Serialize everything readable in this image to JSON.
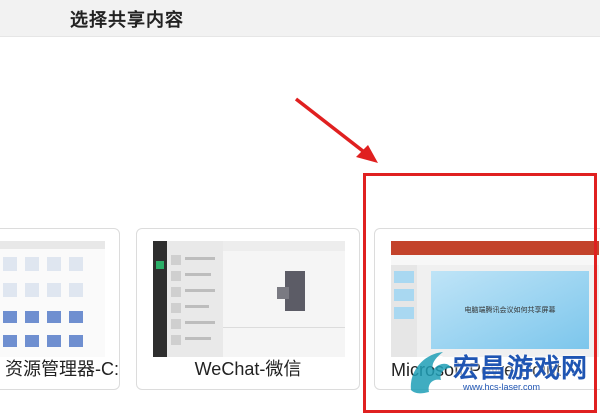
{
  "header": {
    "title": "选择共享内容"
  },
  "windows": [
    {
      "id": "explorer",
      "label": "资源管理器-C:..."
    },
    {
      "id": "wechat",
      "label": "WeChat-微信"
    },
    {
      "id": "ppt",
      "label": "Microsoft PowerPoint",
      "slide_text": "电脑端腾讯会议如何共享屏幕"
    }
  ],
  "watermark": {
    "brand": "宏昌游戏网",
    "url": "www.hcs-laser.com"
  },
  "colors": {
    "highlight": "#e02020",
    "accent": "#1f55b3"
  }
}
